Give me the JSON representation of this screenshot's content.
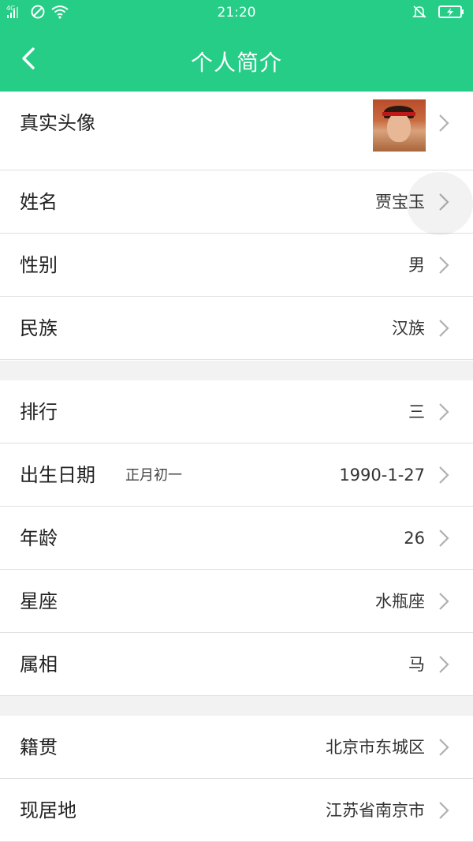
{
  "status_bar": {
    "network": "4G",
    "time": "21:20"
  },
  "nav": {
    "title": "个人简介"
  },
  "sections": [
    {
      "rows": [
        {
          "label": "真实头像",
          "value": "",
          "has_avatar": true
        },
        {
          "label": "姓名",
          "value": "贾宝玉"
        },
        {
          "label": "性别",
          "value": "男"
        },
        {
          "label": "民族",
          "value": "汉族"
        }
      ]
    },
    {
      "rows": [
        {
          "label": "排行",
          "value": "三"
        },
        {
          "label": "出生日期",
          "sublabel": "正月初一",
          "value": "1990-1-27"
        },
        {
          "label": "年龄",
          "value": "26"
        },
        {
          "label": "星座",
          "value": "水瓶座"
        },
        {
          "label": "属相",
          "value": "马"
        }
      ]
    },
    {
      "rows": [
        {
          "label": "籍贯",
          "value": "北京市东城区"
        },
        {
          "label": "现居地",
          "value": "江苏省南京市"
        }
      ]
    }
  ],
  "colors": {
    "accent": "#25cd87",
    "divider": "#e0e0e0",
    "background": "#f2f2f2"
  },
  "icons": {
    "back": "chevron-left-icon",
    "row_arrow": "chevron-right-icon"
  }
}
